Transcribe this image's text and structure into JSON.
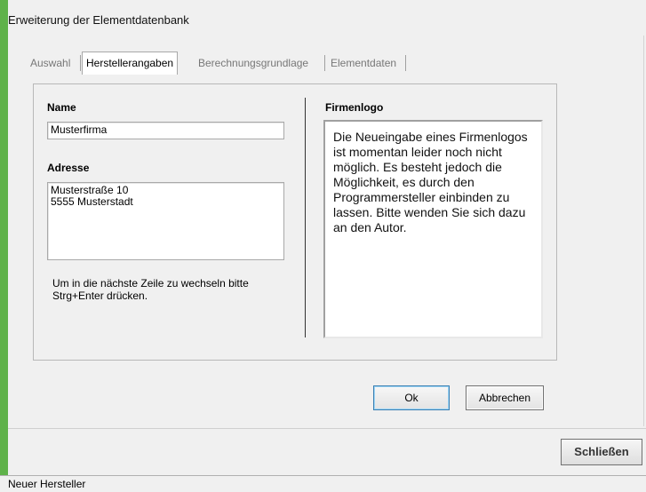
{
  "window": {
    "title": "Erweiterung der Elementdatenbank",
    "accent_color": "#5fb24a"
  },
  "tabs": [
    {
      "label": "Auswahl",
      "active": false
    },
    {
      "label": "Herstellerangaben",
      "active": true
    },
    {
      "label": "Berechnungsgrundlage",
      "active": false
    },
    {
      "label": "Elementdaten",
      "active": false
    }
  ],
  "form": {
    "name_label": "Name",
    "name_value": "Musterfirma",
    "address_label": "Adresse",
    "address_value": "Musterstraße 10\n5555 Musterstadt",
    "hint": "Um in die nächste Zeile zu wechseln bitte Strg+Enter drücken."
  },
  "logo": {
    "label": "Firmenlogo",
    "message": "Die Neueingabe eines Firmenlogos ist momentan leider noch nicht möglich. Es besteht jedoch die Möglichkeit, es durch den Programmersteller einbinden zu lassen. Bitte wenden Sie sich dazu an den Autor."
  },
  "buttons": {
    "ok": "Ok",
    "cancel": "Abbrechen",
    "close": "Schließen"
  },
  "status": {
    "text": "Neuer Hersteller"
  }
}
